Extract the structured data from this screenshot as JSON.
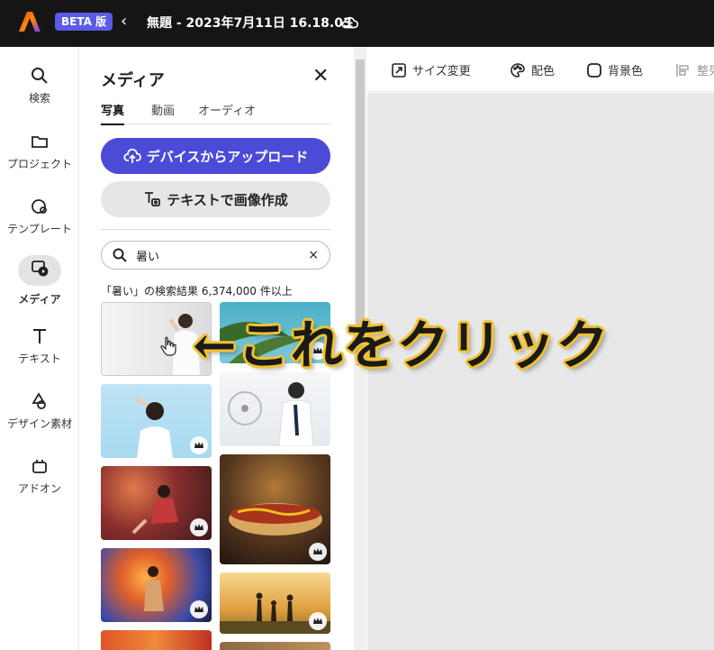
{
  "header": {
    "badge": "BETA 版",
    "back_glyph": "‹",
    "doc_title": "無題 - 2023年7月11日 16.18.03",
    "cloud_icon": "cloud-sync-icon"
  },
  "rail": {
    "items": [
      {
        "label": "検索",
        "icon": "search-icon"
      },
      {
        "label": "プロジェクト",
        "icon": "folder-icon"
      },
      {
        "label": "テンプレート",
        "icon": "template-icon"
      },
      {
        "label": "メディア",
        "icon": "media-icon",
        "active": true
      },
      {
        "label": "テキスト",
        "icon": "text-icon"
      },
      {
        "label": "デザイン素材",
        "icon": "shapes-icon"
      },
      {
        "label": "アドオン",
        "icon": "addon-icon"
      }
    ]
  },
  "panel": {
    "title": "メディア",
    "close": "✕",
    "tabs": [
      "写真",
      "動画",
      "オーディオ"
    ],
    "upload_label": "デバイスからアップロード",
    "generate_label": "テキストで画像作成",
    "search_value": "暑い",
    "search_clear": "×",
    "result_text": "「暑い」の検索結果 6,374,000 件以上"
  },
  "toolbar": {
    "resize": "サイズ変更",
    "colors": "配色",
    "background": "背景色",
    "align": "整列"
  },
  "annotation": "←これをクリック",
  "colors": {
    "accent": "#4b4bd8",
    "topbar": "#151515",
    "annotation_stroke": "#f2c230"
  }
}
